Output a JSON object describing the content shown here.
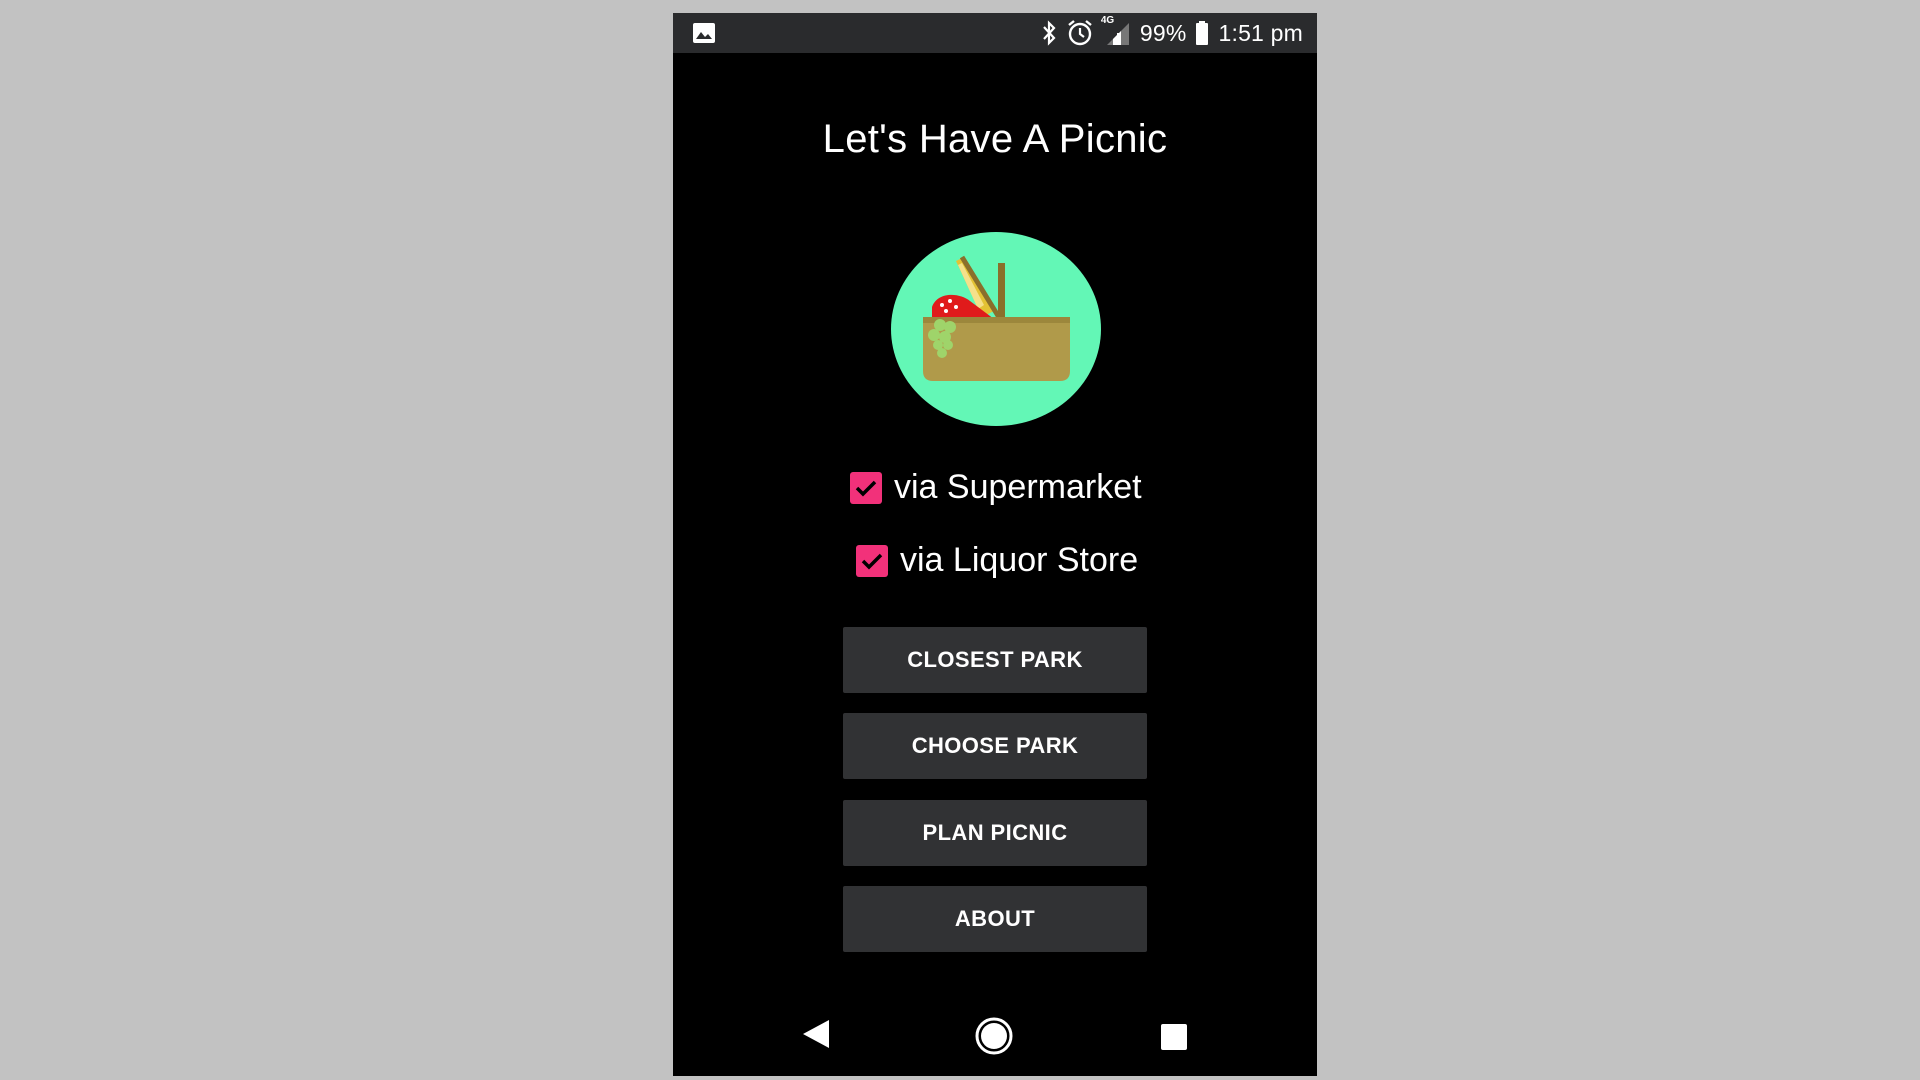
{
  "status_bar": {
    "network_type": "4G",
    "battery_percent": "99%",
    "time": "1:51 pm",
    "icons": [
      "image-notification-icon",
      "bluetooth-icon",
      "alarm-icon",
      "signal-icon",
      "battery-icon"
    ]
  },
  "app": {
    "title": "Let's Have A Picnic",
    "logo": "picnic-basket-icon"
  },
  "options": [
    {
      "label": "via Supermarket",
      "checked": true
    },
    {
      "label": "via Liquor Store",
      "checked": true
    }
  ],
  "buttons": {
    "closest_park": "CLOSEST PARK",
    "choose_park": "CHOOSE PARK",
    "plan_picnic": "PLAN PICNIC",
    "about": "ABOUT"
  },
  "nav_bar": {
    "icons": [
      "back-icon",
      "home-icon",
      "recent-apps-icon"
    ]
  },
  "colors": {
    "background": "#000000",
    "status_bar": "#2a2b2d",
    "checkbox_accent": "#f2317a",
    "button_bg": "#313234",
    "logo_circle": "#63f7b6",
    "basket": "#b09a4a"
  }
}
